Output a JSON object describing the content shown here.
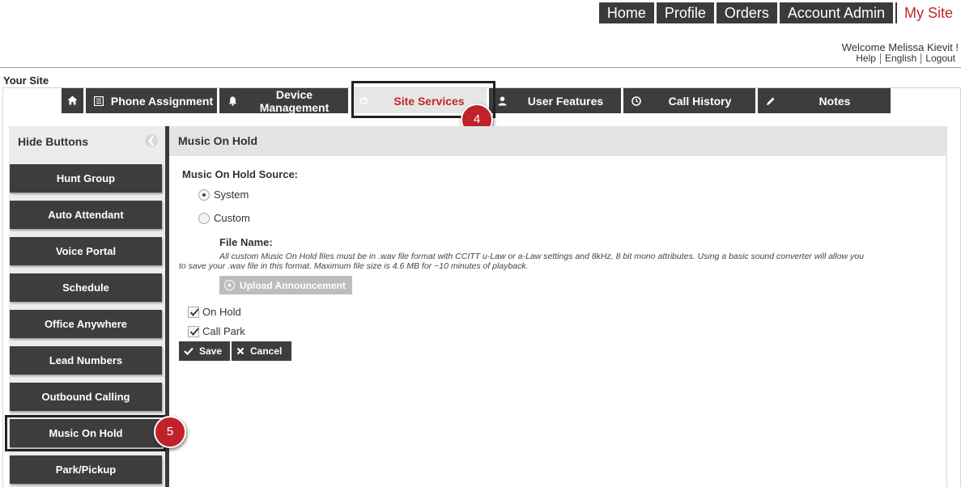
{
  "topnav": {
    "items": [
      {
        "label": "Home"
      },
      {
        "label": "Profile"
      },
      {
        "label": "Orders"
      },
      {
        "label": "Account Admin"
      },
      {
        "label": "My Site"
      }
    ]
  },
  "user": {
    "welcome": "Welcome Melissa Kievit !",
    "links": [
      "Help",
      "English",
      "Logout"
    ]
  },
  "site_title": "Your Site",
  "tabs": [
    {
      "label": "",
      "icon": "home-icon"
    },
    {
      "label": "Phone Assignment",
      "icon": "list-icon"
    },
    {
      "label": "Device Management",
      "icon": "bell-icon"
    },
    {
      "label": "Site Services",
      "icon": "gear-icon",
      "active": true
    },
    {
      "label": "User Features",
      "icon": "user-icon"
    },
    {
      "label": "Call History",
      "icon": "clock-icon"
    },
    {
      "label": "Notes",
      "icon": "pencil-icon"
    }
  ],
  "badges": {
    "tab_step": "4",
    "sidebar_step": "5"
  },
  "sidebar": {
    "header": "Hide Buttons",
    "items": [
      {
        "label": "Hunt Group"
      },
      {
        "label": "Auto Attendant"
      },
      {
        "label": "Voice Portal"
      },
      {
        "label": "Schedule"
      },
      {
        "label": "Office Anywhere"
      },
      {
        "label": "Lead Numbers"
      },
      {
        "label": "Outbound Calling"
      },
      {
        "label": "Music On Hold",
        "active": true
      },
      {
        "label": "Park/Pickup"
      }
    ]
  },
  "panel": {
    "title": "Music On Hold",
    "source_label": "Music On Hold Source:",
    "source_options": [
      {
        "label": "System",
        "selected": true
      },
      {
        "label": "Custom",
        "selected": false
      }
    ],
    "file_name_label": "File Name:",
    "file_note_line1": "All custom Music On Hold files must be in .wav file format with CCITT u-Law or a-Law settings and 8kHz, 8 bit mono attributes. Using a basic sound converter will allow you",
    "file_note_line2": "to save your .wav file in this format. Maximum file size is 4.6 MB for ~10 minutes of playback.",
    "upload_label": "Upload Announcement",
    "checkboxes": [
      {
        "label": "On Hold",
        "checked": true
      },
      {
        "label": "Call Park",
        "checked": true
      }
    ],
    "save_label": "Save",
    "cancel_label": "Cancel"
  },
  "colors": {
    "accent": "#c0272d",
    "dark_button": "#3d3d3d",
    "badge": "#c0222a"
  }
}
